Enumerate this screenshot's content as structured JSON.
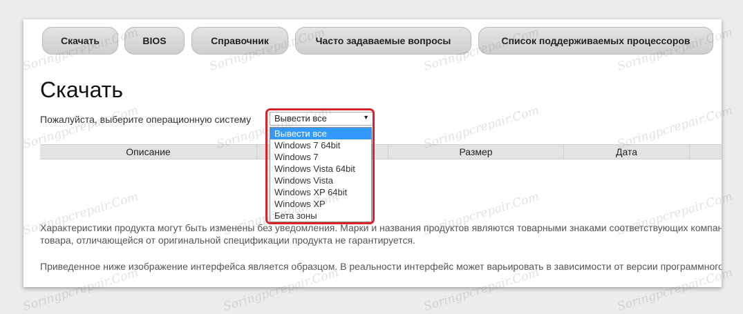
{
  "nav": {
    "items": [
      "Скачать",
      "BIOS",
      "Справочник",
      "Часто задаваемые вопросы",
      "Список поддерживаемых процессоров"
    ]
  },
  "page": {
    "title": "Скачать",
    "os_prompt": "Пожалуйста, выберите операционную систему",
    "os_select_value": "Вывести все"
  },
  "dropdown": {
    "options": [
      "Вывести все",
      "Windows 7 64bit",
      "Windows 7",
      "Windows Vista 64bit",
      "Windows Vista",
      "Windows XP 64bit",
      "Windows XP",
      "Бета зоны"
    ],
    "selected_index": 0
  },
  "table": {
    "columns": [
      "Описание",
      "Размер",
      "Дата"
    ]
  },
  "notes": {
    "line1": "Характеристики продукта могут быть изменены без уведомления. Марки и названия продуктов являются товарными знаками соответствующих компаний",
    "line2": "товара, отличающейся от оригинальной спецификации продукта не гарантируется.",
    "line3": "Приведенное ниже изображение интерфейса является образцом. В реальности интерфейс может варьировать в зависимости от версии программного"
  },
  "watermark": {
    "text": "Soringpcrepair.Com"
  },
  "colors": {
    "highlight": "#d9222a",
    "selected_option": "#3399ff",
    "nav_button": "#d8d8d8",
    "table_header": "#e3e3e3"
  }
}
